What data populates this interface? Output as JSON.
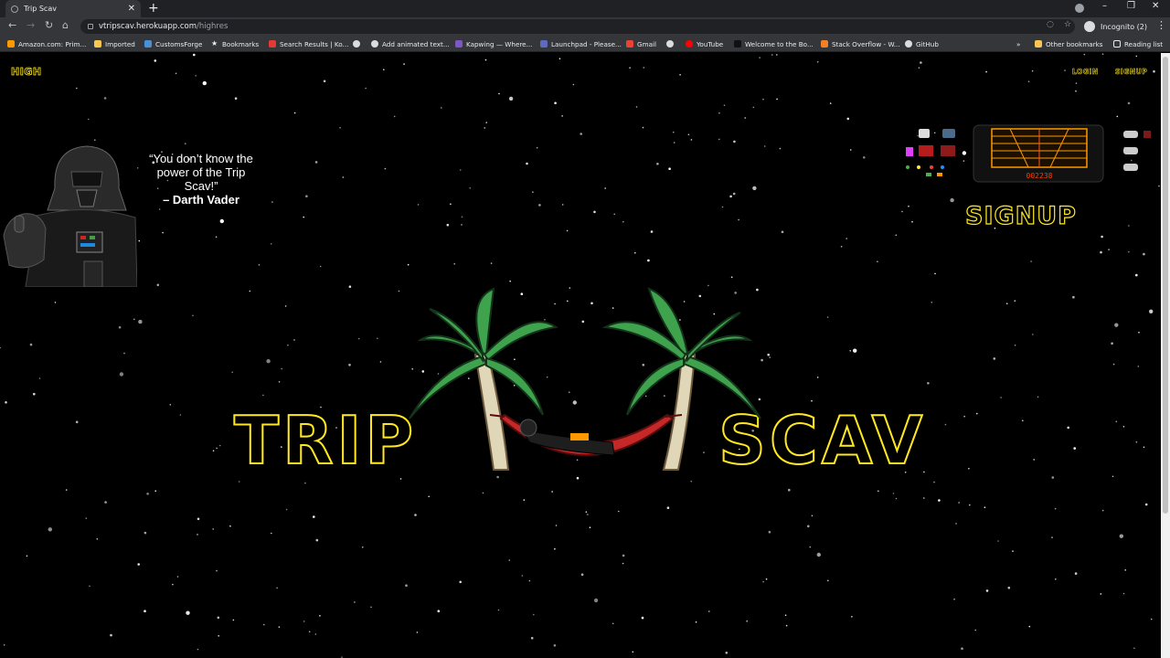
{
  "browser": {
    "tab_title": "Trip Scav",
    "url_host": "vtripscav.herokuapp.com",
    "url_path": "/highres",
    "incognito_label": "Incognito (2)",
    "bookmarks": [
      "Amazon.com: Prim...",
      "Imported",
      "CustomsForge",
      "Bookmarks",
      "Search Results | Ko...",
      "Add animated text...",
      "Kapwing — Where...",
      "Launchpad - Please...",
      "Gmail",
      "YouTube",
      "Welcome to the Bo...",
      "Stack Overflow - W...",
      "GitHub"
    ],
    "other_bookmarks": "Other bookmarks",
    "reading_list": "Reading list"
  },
  "page": {
    "brand": "HIGH",
    "nav_login": "LOGIN",
    "nav_signup": "SIGNUP",
    "quote_text": "“You don’t know the power of the Trip Scav!”",
    "quote_author": "– Darth Vader",
    "signup_big": "SIGNUP",
    "logo_left": "TRIP",
    "logo_right": "SCAV",
    "console_readout": "002238"
  },
  "colors": {
    "accent_yellow": "#ffe81f",
    "background": "#000000"
  }
}
